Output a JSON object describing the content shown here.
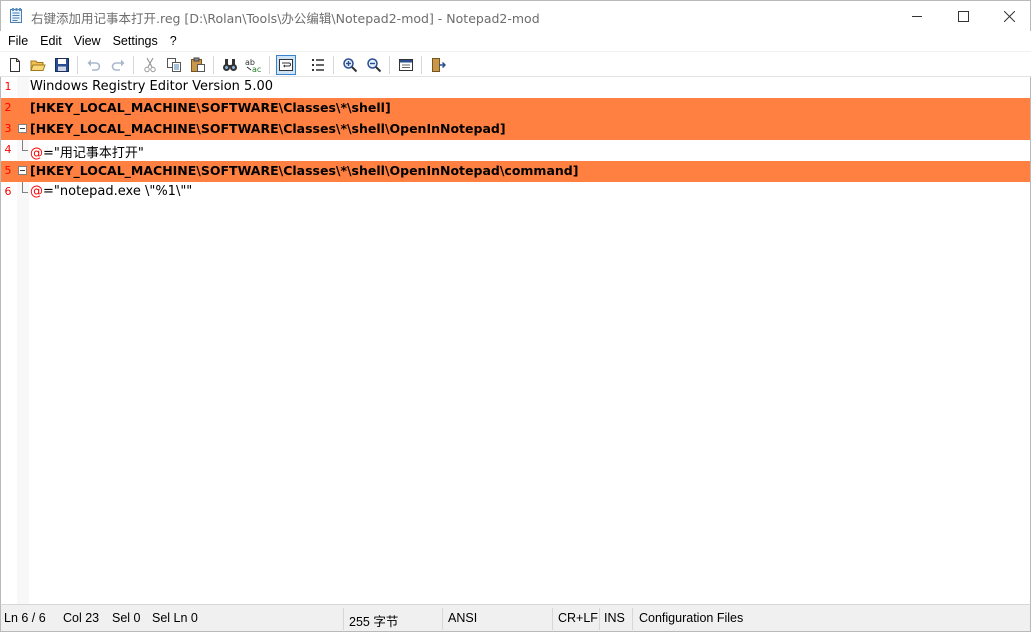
{
  "window": {
    "title": "右键添加用记事本打开.reg [D:\\Rolan\\Tools\\办公编辑\\Notepad2-mod] - Notepad2-mod",
    "controls": [
      "minimize",
      "maximize",
      "close"
    ]
  },
  "menu": {
    "items": [
      "File",
      "Edit",
      "View",
      "Settings",
      "?"
    ]
  },
  "toolbar": {
    "buttons": [
      {
        "icon": "new-file-icon"
      },
      {
        "icon": "open-folder-icon"
      },
      {
        "icon": "save-icon"
      },
      {
        "icon": "undo-icon"
      },
      {
        "icon": "redo-icon"
      },
      {
        "icon": "cut-icon"
      },
      {
        "icon": "copy-icon"
      },
      {
        "icon": "paste-icon"
      },
      {
        "icon": "find-icon"
      },
      {
        "icon": "replace-icon"
      },
      {
        "icon": "word-wrap-icon",
        "pressed": true
      },
      {
        "icon": "show-list-icon"
      },
      {
        "icon": "zoom-in-icon"
      },
      {
        "icon": "zoom-out-icon"
      },
      {
        "icon": "scheme-icon"
      },
      {
        "icon": "exit-icon"
      }
    ]
  },
  "editor": {
    "highlight_color": "#ff8040",
    "line_number_color": "#ff0000",
    "lines": [
      {
        "num": "1",
        "text": "Windows Registry Editor Version 5.00",
        "highlight": false
      },
      {
        "num": "2",
        "text": "[HKEY_LOCAL_MACHINE\\SOFTWARE\\Classes\\*\\shell]",
        "highlight": true
      },
      {
        "num": "3",
        "text": "[HKEY_LOCAL_MACHINE\\SOFTWARE\\Classes\\*\\shell\\OpenInNotepad]",
        "highlight": true
      },
      {
        "num": "4",
        "at": "@",
        "text": "=\"用记事本打开\"",
        "highlight": false
      },
      {
        "num": "5",
        "text": "[HKEY_LOCAL_MACHINE\\SOFTWARE\\Classes\\*\\shell\\OpenInNotepad\\command]",
        "highlight": true
      },
      {
        "num": "6",
        "at": "@",
        "text": "=\"notepad.exe \\\"%1\\\"\"",
        "highlight": false
      }
    ]
  },
  "status": {
    "position": "Ln 6 / 6",
    "col": "Col 23",
    "sel": "Sel 0",
    "sel_ln": "Sel Ln 0",
    "size": "255 字节",
    "encoding": "ANSI",
    "eol": "CR+LF",
    "mode": "INS",
    "scheme": "Configuration Files"
  }
}
